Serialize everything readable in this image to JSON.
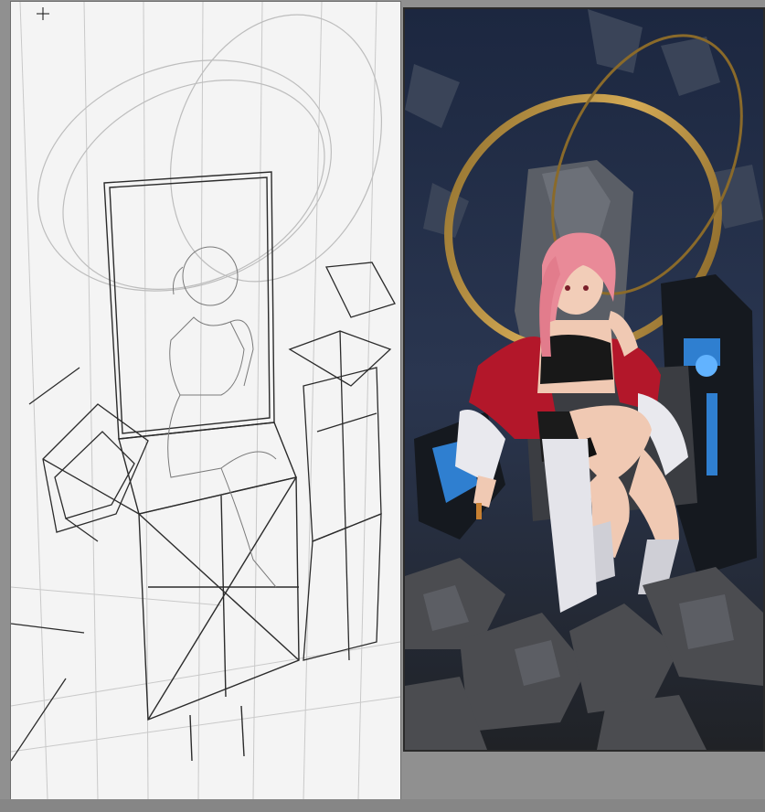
{
  "canvas": {
    "tool": "pencil-crosshair-cursor"
  },
  "colors": {
    "workspace_bg": "#909090",
    "canvas_paper": "#f4f4f4",
    "sketch_line": "#2b2b2b",
    "construction_line": "#c4c4c4",
    "hair_pink": "#e98a98",
    "jacket_red": "#b3172a",
    "halo_gold": "#b58a33",
    "mech_blue": "#2f7fd0",
    "bg_dark_blue": "#1f2c42",
    "rubble_gray": "#4b4c50"
  }
}
